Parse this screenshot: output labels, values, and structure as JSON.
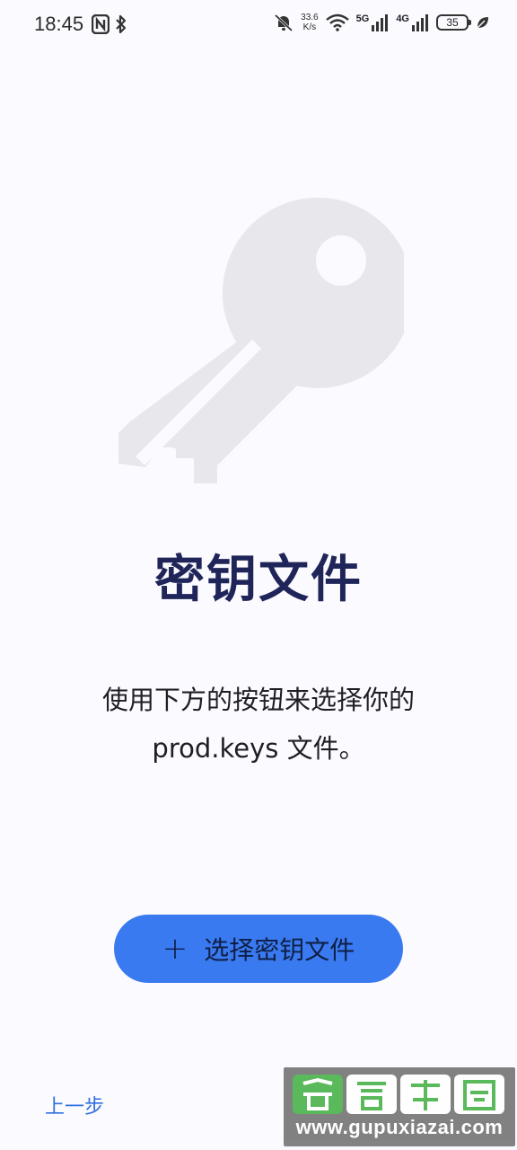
{
  "status_bar": {
    "time": "18:45",
    "net_speed_value": "33.6",
    "net_speed_unit": "K/s",
    "signal_1_label": "5G",
    "signal_2_label": "4G",
    "battery_level": "35",
    "icons": [
      "nfc-icon",
      "bluetooth-icon",
      "mute-bell-icon",
      "wifi-icon",
      "signal-icon",
      "leaf-icon"
    ]
  },
  "main": {
    "illustration_icon": "key-icon",
    "title": "密钥文件",
    "description_line1": "使用下方的按钮来选择你的",
    "description_line2": "prod.keys 文件。",
    "select_button_label": "选择密钥文件"
  },
  "footer": {
    "back_label": "上一步"
  },
  "watermark": {
    "url": "www.gupuxiazai.com"
  },
  "colors": {
    "background": "#fbfafe",
    "title": "#1f2558",
    "primary_button": "#3a7af0",
    "link": "#2f6fe0",
    "illustration": "#e8e8ec"
  }
}
